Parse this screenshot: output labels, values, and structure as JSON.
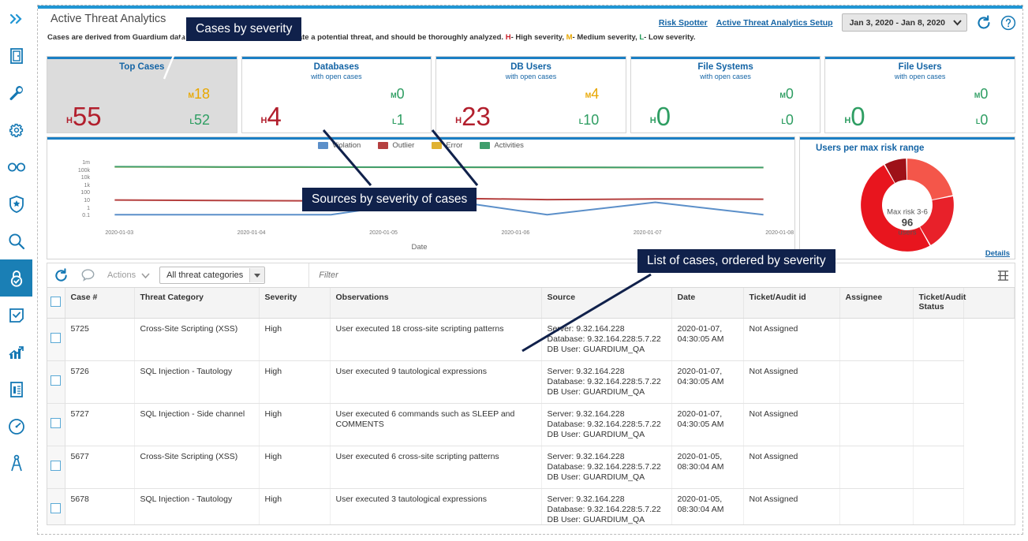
{
  "header": {
    "title": "Active Threat Analytics",
    "subtitle_pre": "Cases are derived from Guardium data ",
    "subtitle_mid": "and outlier mining. Cases indicate a potential threat, and should be thoroughly analyzed. ",
    "sev_h": "H",
    "sev_h_text": "- High severity, ",
    "sev_m": "M",
    "sev_m_text": "- Medium severity, ",
    "sev_l": "L",
    "sev_l_text": "- Low severity.",
    "links": [
      {
        "label": "Risk Spotter"
      },
      {
        "label": "Active Threat Analytics Setup"
      }
    ],
    "date_range": "Jan 3, 2020 - Jan 8, 2020",
    "refresh_icon": "refresh-icon",
    "help_icon": "help-icon"
  },
  "kpis": [
    {
      "title": "Top Cases",
      "sub": "",
      "h": "55",
      "m": "18",
      "l": "52",
      "selected": true,
      "h_color": "#b21f2d",
      "m_color": "#e8a700",
      "l_color": "#2f9e63"
    },
    {
      "title": "Databases",
      "sub": "with open cases",
      "h": "4",
      "m": "0",
      "l": "1",
      "selected": false,
      "h_color": "#b21f2d",
      "m_color": "#2f9e63",
      "l_color": "#2f9e63"
    },
    {
      "title": "DB Users",
      "sub": "with open cases",
      "h": "23",
      "m": "4",
      "l": "10",
      "selected": false,
      "h_color": "#b21f2d",
      "m_color": "#e8a700",
      "l_color": "#2f9e63"
    },
    {
      "title": "File Systems",
      "sub": "with open cases",
      "h": "0",
      "m": "0",
      "l": "0",
      "selected": false,
      "h_color": "#2f9e63",
      "m_color": "#2f9e63",
      "l_color": "#2f9e63"
    },
    {
      "title": "File Users",
      "sub": "with open cases",
      "h": "0",
      "m": "0",
      "l": "0",
      "selected": false,
      "h_color": "#2f9e63",
      "m_color": "#2f9e63",
      "l_color": "#2f9e63"
    }
  ],
  "chart_data": [
    {
      "type": "line",
      "title": "",
      "xlabel": "Date",
      "ylabel": "",
      "yscale": "log",
      "ytick_labels": [
        "1m",
        "100k",
        "10k",
        "1k",
        "100",
        "10",
        "1",
        "0.1"
      ],
      "x": [
        "2020-01-03",
        "2020-01-04",
        "2020-01-05",
        "2020-01-06",
        "2020-01-07",
        "2020-01-08"
      ],
      "legend_position": "top-center",
      "series": [
        {
          "name": "Violation",
          "color": "#5b8fc9",
          "values": [
            0.1,
            0.1,
            0.1,
            10,
            0.1,
            4,
            0.1
          ]
        },
        {
          "name": "Outlier",
          "color": "#b5403f",
          "values": [
            8,
            7,
            6,
            14,
            9,
            11,
            10
          ]
        },
        {
          "name": "Error",
          "color": "#e0b232",
          "values": [
            160000,
            150000,
            145000,
            140000,
            135000,
            130000,
            128000
          ]
        },
        {
          "name": "Activities",
          "color": "#3f9e6c",
          "values": [
            165000,
            155000,
            150000,
            145000,
            140000,
            135000,
            132000
          ]
        }
      ]
    },
    {
      "type": "pie",
      "title": "Users per max risk range",
      "center_label": "Max risk 3-6",
      "center_value": "96",
      "center_unit": "users",
      "details_link": "Details",
      "slices": [
        {
          "name": "segment-1",
          "value": 22,
          "color": "#f4564a"
        },
        {
          "name": "segment-2",
          "value": 20,
          "color": "#e8212a"
        },
        {
          "name": "segment-3",
          "value": 50,
          "color": "#e8151e"
        },
        {
          "name": "segment-4",
          "value": 8,
          "color": "#9e1118"
        }
      ]
    }
  ],
  "toolbar": {
    "refresh_icon": "refresh-icon",
    "comment_icon": "comment-icon",
    "actions_label": "Actions",
    "category_select": "All threat categories",
    "filter_placeholder": "Filter",
    "columns_icon": "columns-icon"
  },
  "table": {
    "columns": [
      "Case #",
      "Threat Category",
      "Severity",
      "Observations",
      "Source",
      "Date",
      "Ticket/Audit id",
      "Assignee",
      "Ticket/Audit Status"
    ],
    "rows": [
      {
        "case": "5725",
        "category": "Cross-Site Scripting (XSS)",
        "severity": "High",
        "observations": "User executed 18 cross-site scripting patterns",
        "source_server": "Server: 9.32.164.228",
        "source_db": "Database: 9.32.164.228:5.7.22",
        "source_user": "DB User: GUARDIUM_QA",
        "date": "2020-01-07,",
        "time": "04:30:05 AM",
        "ticket": "Not Assigned",
        "assignee": "",
        "status": ""
      },
      {
        "case": "5726",
        "category": "SQL Injection - Tautology",
        "severity": "High",
        "observations": "User executed 9 tautological expressions",
        "source_server": "Server: 9.32.164.228",
        "source_db": "Database: 9.32.164.228:5.7.22",
        "source_user": "DB User: GUARDIUM_QA",
        "date": "2020-01-07,",
        "time": "04:30:05 AM",
        "ticket": "Not Assigned",
        "assignee": "",
        "status": ""
      },
      {
        "case": "5727",
        "category": "SQL Injection - Side channel",
        "severity": "High",
        "observations": "User executed 6 commands such as SLEEP and COMMENTS",
        "source_server": "Server: 9.32.164.228",
        "source_db": "Database: 9.32.164.228:5.7.22",
        "source_user": "DB User: GUARDIUM_QA",
        "date": "2020-01-07,",
        "time": "04:30:05 AM",
        "ticket": "Not Assigned",
        "assignee": "",
        "status": ""
      },
      {
        "case": "5677",
        "category": "Cross-Site Scripting (XSS)",
        "severity": "High",
        "observations": "User executed 6 cross-site scripting patterns",
        "source_server": "Server: 9.32.164.228",
        "source_db": "Database: 9.32.164.228:5.7.22",
        "source_user": "DB User: GUARDIUM_QA",
        "date": "2020-01-05,",
        "time": "08:30:04 AM",
        "ticket": "Not Assigned",
        "assignee": "",
        "status": ""
      },
      {
        "case": "5678",
        "category": "SQL Injection - Tautology",
        "severity": "High",
        "observations": "User executed 3 tautological expressions",
        "source_server": "Server: 9.32.164.228",
        "source_db": "Database: 9.32.164.228:5.7.22",
        "source_user": "DB User: GUARDIUM_QA",
        "date": "2020-01-05,",
        "time": "08:30:04 AM",
        "ticket": "Not Assigned",
        "assignee": "",
        "status": ""
      }
    ]
  },
  "callouts": [
    {
      "text": "Cases by severity"
    },
    {
      "text": "Sources by severity of cases"
    },
    {
      "text": "List of cases, ordered by severity"
    }
  ],
  "rail": [
    {
      "name": "expand-icon",
      "active": false
    },
    {
      "name": "door-icon",
      "active": false
    },
    {
      "name": "wrench-icon",
      "active": false
    },
    {
      "name": "gear-icon",
      "active": false
    },
    {
      "name": "glasses-icon",
      "active": false
    },
    {
      "name": "shield-star-icon",
      "active": false
    },
    {
      "name": "search-icon",
      "active": false
    },
    {
      "name": "lock-check-icon",
      "active": true
    },
    {
      "name": "checklist-icon",
      "active": false
    },
    {
      "name": "chart-up-icon",
      "active": false
    },
    {
      "name": "report-icon",
      "active": false
    },
    {
      "name": "gauge-icon",
      "active": false
    },
    {
      "name": "compass-icon",
      "active": false
    }
  ]
}
